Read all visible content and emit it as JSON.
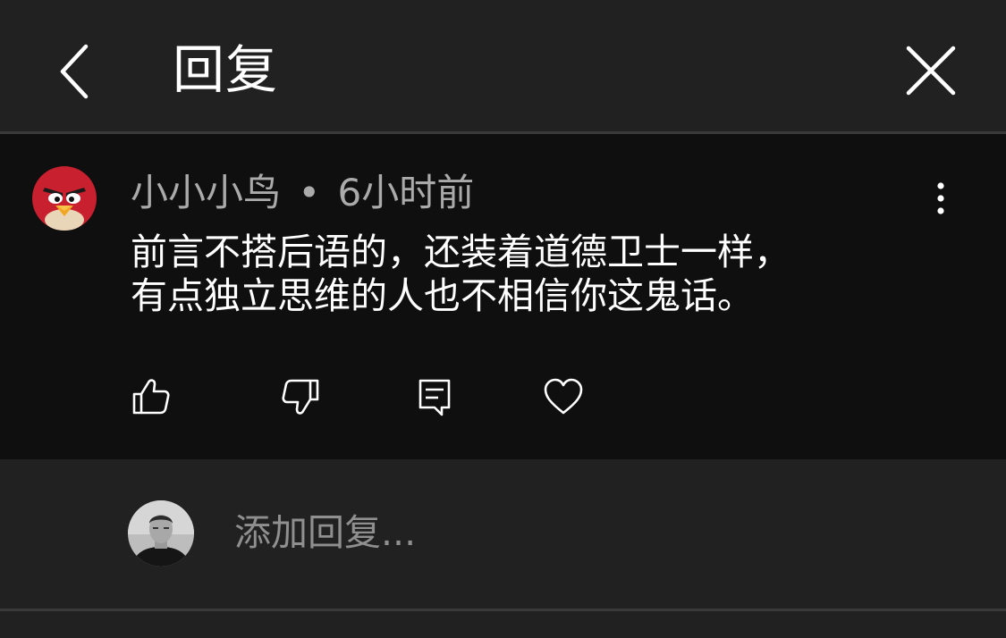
{
  "header": {
    "title": "回复",
    "back_icon": "chevron-left-icon",
    "close_icon": "close-icon"
  },
  "comment": {
    "author": "小小小鸟",
    "separator": "•",
    "time": "6小时前",
    "text_lines": [
      "前言不搭后语的，还装着道德卫士一样，",
      "有点独立思维的人也不相信你这鬼话。"
    ],
    "actions": [
      "thumbs-up-icon",
      "thumbs-down-icon",
      "reply-icon",
      "heart-icon"
    ]
  },
  "reply": {
    "placeholder": "添加回复..."
  },
  "colors": {
    "background": "#212121",
    "comment_background": "#0f0f0f",
    "text": "#ffffff",
    "muted_text": "#aaaaaa",
    "placeholder": "#8f8f8f",
    "avatar_red": "#c8202e"
  }
}
